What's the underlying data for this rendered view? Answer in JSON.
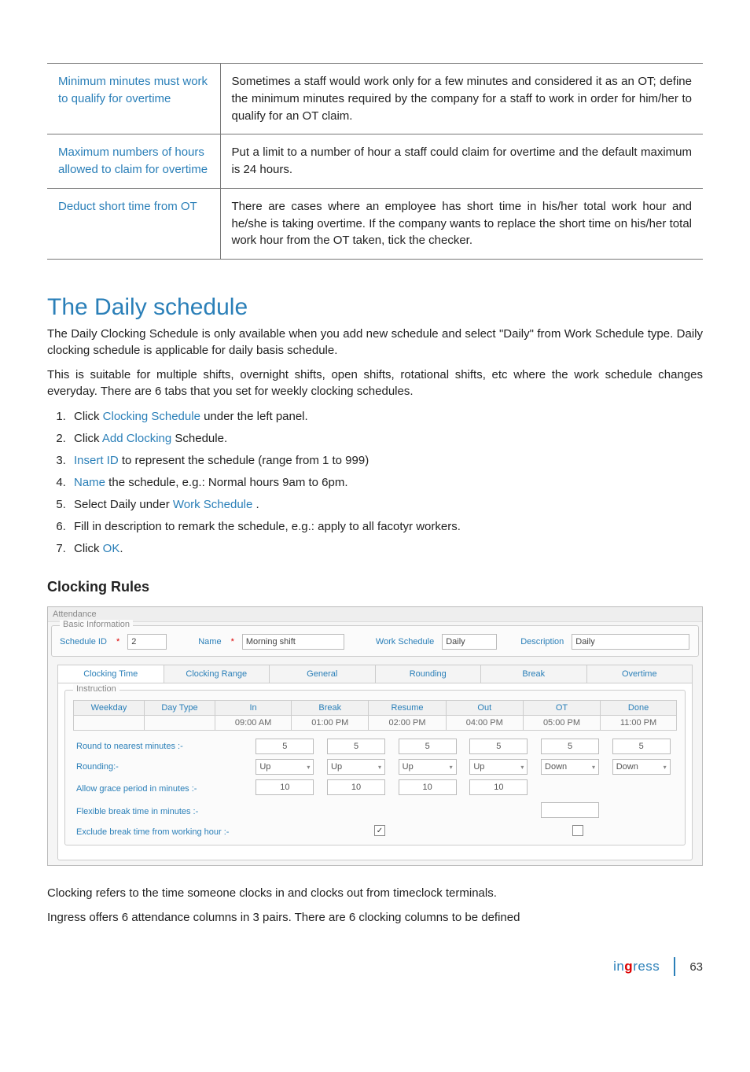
{
  "table": {
    "rows": [
      {
        "label": "Minimum minutes must work to qualify for overtime",
        "desc": "Sometimes a staff would work only for a few minutes and considered it as an OT; define the minimum minutes required by the company for a staff to work in order for him/her to qualify for an OT claim."
      },
      {
        "label": "Maximum numbers of hours allowed to claim for overtime",
        "desc": "Put a limit to a number of hour a staff could claim for overtime and the default maximum is 24 hours."
      },
      {
        "label": "Deduct short time from OT",
        "desc": "There are cases where an employee has short time in his/her total work hour and he/she is taking overtime. If the company wants to replace the short time on his/her total work hour from the OT taken, tick the checker."
      }
    ]
  },
  "heading": "The Daily schedule",
  "paras": [
    "The Daily Clocking Schedule is only available when you add new schedule and select \"Daily\" from Work Schedule type. Daily clocking schedule is applicable for daily basis schedule.",
    "This is suitable for multiple shifts, overnight shifts, open shifts, rotational shifts, etc where the work schedule changes everyday. There are 6 tabs that you set for weekly clocking schedules."
  ],
  "steps": [
    {
      "pre": "Click ",
      "link": "Clocking Schedule",
      "post": " under the left panel."
    },
    {
      "pre": "Click ",
      "link": "Add Clocking",
      "post": " Schedule."
    },
    {
      "pre": "",
      "link": "Insert ID",
      "post": " to represent the schedule (range from 1 to 999)"
    },
    {
      "pre": "",
      "link": "Name",
      "post": " the schedule, e.g.: Normal hours 9am to 6pm."
    },
    {
      "pre": "Select Daily under ",
      "link": "Work Schedule",
      "post": " ."
    },
    {
      "pre": "Fill in description to remark the schedule, e.g.: apply to all facotyr workers.",
      "link": "",
      "post": ""
    },
    {
      "pre": "Click ",
      "link": "OK",
      "post": "."
    }
  ],
  "subheading": "Clocking Rules",
  "screenshot": {
    "window_title": "Attendance",
    "basic_legend": "Basic Information",
    "fields": {
      "schedule_id_label": "Schedule ID",
      "schedule_id_value": "2",
      "name_label": "Name",
      "name_value": "Morning shift",
      "work_schedule_label": "Work Schedule",
      "work_schedule_value": "Daily",
      "description_label": "Description",
      "description_value": "Daily"
    },
    "tabs": [
      "Clocking Time",
      "Clocking Range",
      "General",
      "Rounding",
      "Break",
      "Overtime"
    ],
    "instruction_legend": "Instruction",
    "grid_headers": [
      "Weekday",
      "Day Type",
      "In",
      "Break",
      "Resume",
      "Out",
      "OT",
      "Done"
    ],
    "grid_times": [
      "",
      "",
      "09:00 AM",
      "01:00 PM",
      "02:00 PM",
      "04:00 PM",
      "05:00 PM",
      "11:00 PM"
    ],
    "rows": {
      "round_label": "Round to nearest minutes :-",
      "round_vals": [
        "5",
        "5",
        "5",
        "5",
        "5",
        "5"
      ],
      "rounding_label": "Rounding:-",
      "rounding_vals": [
        "Up",
        "Up",
        "Up",
        "Up",
        "Down",
        "Down"
      ],
      "grace_label": "Allow grace period in minutes :-",
      "grace_vals": [
        "10",
        "10",
        "10",
        "10",
        "",
        ""
      ],
      "flex_label": "Flexible break time in minutes :-",
      "flex_val": "",
      "exclude_label": "Exclude break time from working hour :-",
      "exclude_checked": true
    }
  },
  "closing": [
    "Clocking refers to the time someone clocks in and clocks out from timeclock terminals.",
    "Ingress offers 6 attendance columns in 3 pairs. There are 6 clocking columns to be defined"
  ],
  "footer": {
    "brand_pre": "in",
    "brand_g": "g",
    "brand_post": "ress",
    "page": "63"
  },
  "chart_data": {
    "type": "table",
    "title": "Clocking Rules — schedule rounding grid",
    "columns": [
      "In",
      "Break",
      "Resume",
      "Out",
      "OT",
      "Done"
    ],
    "times": [
      "09:00 AM",
      "01:00 PM",
      "02:00 PM",
      "04:00 PM",
      "05:00 PM",
      "11:00 PM"
    ],
    "round_to_nearest_minutes": [
      5,
      5,
      5,
      5,
      5,
      5
    ],
    "rounding_direction": [
      "Up",
      "Up",
      "Up",
      "Up",
      "Down",
      "Down"
    ],
    "grace_period_minutes": [
      10,
      10,
      10,
      10,
      null,
      null
    ],
    "flexible_break_minutes": null,
    "exclude_break_from_working_hour": true
  }
}
